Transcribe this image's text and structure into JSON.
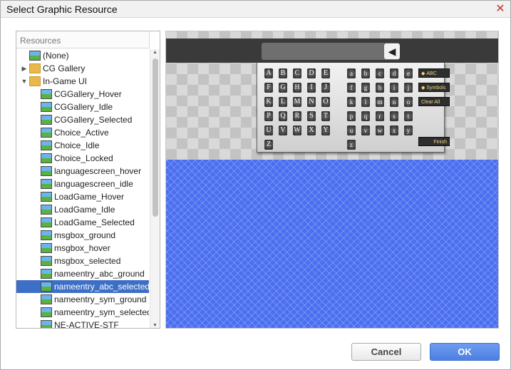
{
  "dialog": {
    "title": "Select Graphic Resource",
    "close_glyph": "✕"
  },
  "resources": {
    "header": "Resources",
    "items": [
      {
        "label": "(None)",
        "type": "image",
        "level": 0,
        "expander": ""
      },
      {
        "label": "CG Gallery",
        "type": "folder",
        "level": 0,
        "expander": "collapsed"
      },
      {
        "label": "In-Game UI",
        "type": "folder",
        "level": 0,
        "expander": "expanded"
      },
      {
        "label": "CGGallery_Hover",
        "type": "image",
        "level": 1,
        "expander": ""
      },
      {
        "label": "CGGallery_Idle",
        "type": "image",
        "level": 1,
        "expander": ""
      },
      {
        "label": "CGGallery_Selected",
        "type": "image",
        "level": 1,
        "expander": ""
      },
      {
        "label": "Choice_Active",
        "type": "image",
        "level": 1,
        "expander": ""
      },
      {
        "label": "Choice_Idle",
        "type": "image",
        "level": 1,
        "expander": ""
      },
      {
        "label": "Choice_Locked",
        "type": "image",
        "level": 1,
        "expander": ""
      },
      {
        "label": "languagescreen_hover",
        "type": "image",
        "level": 1,
        "expander": ""
      },
      {
        "label": "languagescreen_idle",
        "type": "image",
        "level": 1,
        "expander": ""
      },
      {
        "label": "LoadGame_Hover",
        "type": "image",
        "level": 1,
        "expander": ""
      },
      {
        "label": "LoadGame_Idle",
        "type": "image",
        "level": 1,
        "expander": ""
      },
      {
        "label": "LoadGame_Selected",
        "type": "image",
        "level": 1,
        "expander": ""
      },
      {
        "label": "msgbox_ground",
        "type": "image",
        "level": 1,
        "expander": ""
      },
      {
        "label": "msgbox_hover",
        "type": "image",
        "level": 1,
        "expander": ""
      },
      {
        "label": "msgbox_selected",
        "type": "image",
        "level": 1,
        "expander": ""
      },
      {
        "label": "nameentry_abc_ground",
        "type": "image",
        "level": 1,
        "expander": ""
      },
      {
        "label": "nameentry_abc_selected",
        "type": "image",
        "level": 1,
        "expander": "",
        "selected": true
      },
      {
        "label": "nameentry_sym_ground",
        "type": "image",
        "level": 1,
        "expander": ""
      },
      {
        "label": "nameentry_sym_selected",
        "type": "image",
        "level": 1,
        "expander": ""
      },
      {
        "label": "NE-ACTIVE-STF",
        "type": "image",
        "level": 1,
        "expander": ""
      }
    ]
  },
  "preview": {
    "backspace_glyph": "◀",
    "upper_keys": [
      "A",
      "B",
      "C",
      "D",
      "E",
      "F",
      "G",
      "H",
      "I",
      "J",
      "K",
      "L",
      "M",
      "N",
      "O",
      "P",
      "Q",
      "R",
      "S",
      "T",
      "U",
      "V",
      "W",
      "X",
      "Y",
      "Z"
    ],
    "lower_keys": [
      "a",
      "b",
      "c",
      "d",
      "e",
      "f",
      "g",
      "h",
      "i",
      "j",
      "k",
      "l",
      "m",
      "n",
      "o",
      "p",
      "q",
      "r",
      "s",
      "t",
      "u",
      "v",
      "w",
      "x",
      "y",
      "z"
    ],
    "func_buttons": [
      "ABC",
      "Symbols",
      "Clear All"
    ],
    "finish_label": "Finish",
    "colors": {
      "blue_fill": "#4b6ff0",
      "panel_bar": "#3a3a3a"
    }
  },
  "buttons": {
    "cancel": "Cancel",
    "ok": "OK"
  },
  "colors": {
    "selection": "#3e6fc6",
    "ok_button": "#4c7fe2"
  }
}
